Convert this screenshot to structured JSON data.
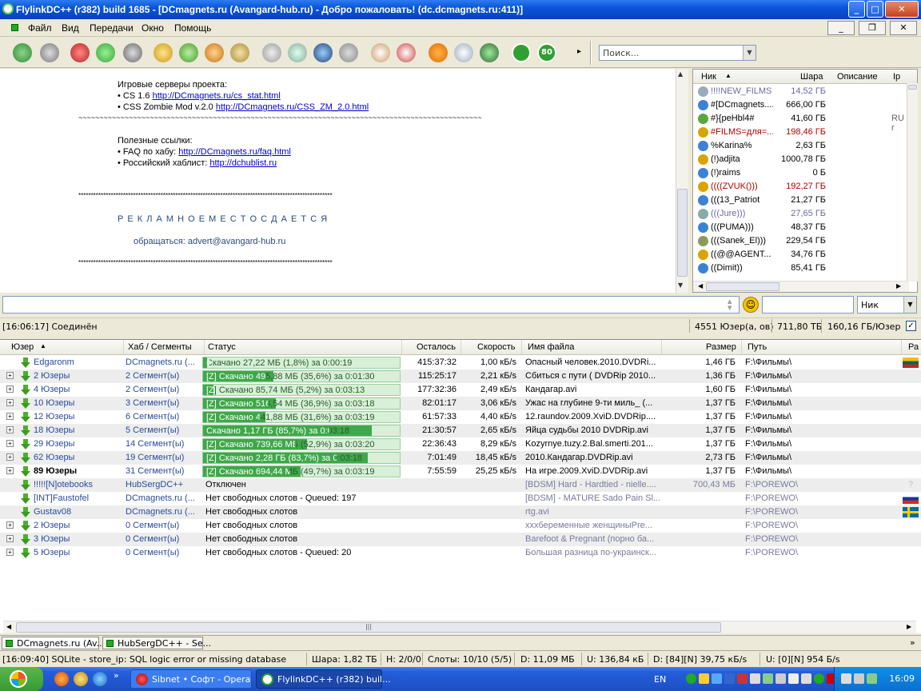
{
  "window": {
    "title": "FlylinkDC++ (r382) build 1685 - [DCmagnets.ru (Avangard-hub.ru) -  Добро пожаловать! (dc.dcmagnets.ru:411)]",
    "minimize": "_",
    "maximize": "□",
    "close": "✕"
  },
  "menu": {
    "items": [
      "Файл",
      "Вид",
      "Передачи",
      "Окно",
      "Помощь"
    ],
    "mdi_min": "_",
    "mdi_restore": "❐",
    "mdi_close": "✕"
  },
  "toolbar": {
    "search_placeholder": "Поиск...",
    "counter_badge": "80"
  },
  "chat": {
    "line1": "Игровые серверы проекта:",
    "line2_prefix": "• CS 1.6 ",
    "line2_link": "http://DCmagnets.ru/cs_stat.html",
    "line3_prefix": "• CSS Zombie Mod v.2.0 ",
    "line3_link": "http://DCmagnets.ru/CSS_ZM_2.0.html",
    "sep_tilde": "~~~~~~~~~~~~~~~~~~~~~~~~~~~~~~~~~~~~~~~~~~~~~~~~~~~~~~~~~~~~~~~~~~~~~~~~~~~~~~~~~~~~~~~~~~~~~~~~",
    "line4": "Полезные ссылки:",
    "line5_prefix": "• FAQ по хабу: ",
    "line5_link": "http://DCmagnets.ru/faq.html",
    "line6_prefix": "• Российский хаблист: ",
    "line6_link": "http://dchublist.ru",
    "sep_star": "******************************************************************************************************",
    "ad": "Р Е К Л А М Н О Е   М Е С Т О   С Д А Е Т С Я",
    "ad_contact": "обращаться: advert@avangard-hub.ru"
  },
  "userlist": {
    "headers": {
      "nick": "Ник",
      "share": "Шара",
      "desc": "Описание",
      "ip": "Ip"
    },
    "rows": [
      {
        "nick": "!!!!NEW_FILMS",
        "share": "14,52 ГБ",
        "desc": "",
        "color": "#6a6a9a",
        "icon": "#9ab"
      },
      {
        "nick": "#[DCmagnets....",
        "share": "666,00 ГБ",
        "desc": "",
        "color": "#000",
        "icon": "#3b82d6"
      },
      {
        "nick": "#}{peHbl4#",
        "share": "41,60 ГБ",
        "desc": "RU r",
        "color": "#000",
        "icon": "#5aa83a"
      },
      {
        "nick": "#FILMS=для=...",
        "share": "198,46 ГБ",
        "desc": "",
        "color": "#b00000",
        "icon": "#d9a400"
      },
      {
        "nick": "%Karina%",
        "share": "2,63 ГБ",
        "desc": "",
        "color": "#000",
        "icon": "#3b82d6"
      },
      {
        "nick": "(!)adjita",
        "share": "1000,78 ГБ",
        "desc": "",
        "color": "#000",
        "icon": "#d9a400"
      },
      {
        "nick": "(!)raims",
        "share": "0 Б",
        "desc": "",
        "color": "#000",
        "icon": "#3b82d6"
      },
      {
        "nick": "((((ZVUK()))",
        "share": "192,27 ГБ",
        "desc": "",
        "color": "#b00000",
        "icon": "#d9a400"
      },
      {
        "nick": "(((13_Patriot",
        "share": "21,27 ГБ",
        "desc": "",
        "color": "#000",
        "icon": "#3b82d6"
      },
      {
        "nick": "(((Jure)))",
        "share": "27,65 ГБ",
        "desc": "",
        "color": "#6a6a9a",
        "icon": "#8aa"
      },
      {
        "nick": "(((PUMA)))",
        "share": "48,37 ГБ",
        "desc": "",
        "color": "#000",
        "icon": "#3b82d6"
      },
      {
        "nick": "(((Sanek_El)))",
        "share": "229,54 ГБ",
        "desc": "",
        "color": "#000",
        "icon": "#8a9a5a"
      },
      {
        "nick": "((@@AGENT...",
        "share": "34,76 ГБ",
        "desc": "",
        "color": "#000",
        "icon": "#d9a400"
      },
      {
        "nick": "((Dimit))",
        "share": "85,41 ГБ",
        "desc": "",
        "color": "#000",
        "icon": "#3b82d6"
      }
    ]
  },
  "filter": {
    "nick_select": "Ник",
    "smiley": "☺"
  },
  "status": {
    "connected": "[16:06:17] Соединён",
    "users": "4551 Юзер(а, ов)",
    "total_share": "711,80 ТБ",
    "per_user": "160,16 ГБ/Юзер"
  },
  "queue": {
    "headers": [
      "Юзер",
      "Хаб / Сегменты",
      "Статус",
      "Осталось",
      "Скорость",
      "Имя файла",
      "Размер",
      "Путь",
      "Ра"
    ],
    "rows": [
      {
        "exp": false,
        "user": "Edgaronm",
        "hub": "DCmagnets.ru (...",
        "status": "Скачано 27,22 МБ (1,8%) за 0:00:19",
        "bar": true,
        "fill": 0.02,
        "left": "415:37:32",
        "speed": "1,00 кБ/s",
        "file": "Опасный человек.2010.DVDRi...",
        "size": "1,46 ГБ",
        "path": "F:\\Фильмы\\",
        "active": true,
        "flag": "lt"
      },
      {
        "exp": true,
        "user": "2 Юзеры",
        "hub": "2 Сегмент(ы)",
        "status": "[Z] Скачано 495,88 МБ (35,6%) за 0:01:30",
        "bar": true,
        "fill": 0.356,
        "left": "115:25:17",
        "speed": "2,21 кБ/s",
        "file": "Сбиться с пути ( DVDRip 2010...",
        "size": "1,36 ГБ",
        "path": "F:\\Фильмы\\",
        "active": true,
        "flag": ""
      },
      {
        "exp": true,
        "user": "4 Юзеры",
        "hub": "2 Сегмент(ы)",
        "status": "[Z] Скачано 85,74 МБ (5,2%) за 0:03:13",
        "bar": true,
        "fill": 0.052,
        "left": "177:32:36",
        "speed": "2,49 кБ/s",
        "file": "Кандагар.avi",
        "size": "1,60 ГБ",
        "path": "F:\\Фильмы\\",
        "active": true,
        "flag": ""
      },
      {
        "exp": true,
        "user": "10 Юзеры",
        "hub": "3 Сегмент(ы)",
        "status": "[Z] Скачано 516,54 МБ (36,9%) за 0:03:18",
        "bar": true,
        "fill": 0.369,
        "left": "82:01:17",
        "speed": "3,06 кБ/s",
        "file": "Ужас на глубине 9-ти миль_ (...",
        "size": "1,37 ГБ",
        "path": "F:\\Фильмы\\",
        "active": true,
        "flag": ""
      },
      {
        "exp": true,
        "user": "12 Юзеры",
        "hub": "6 Сегмент(ы)",
        "status": "[Z] Скачано 441,88 МБ (31,6%) за 0:03:19",
        "bar": true,
        "fill": 0.316,
        "left": "61:57:33",
        "speed": "4,40 кБ/s",
        "file": "12.raundov.2009.XviD.DVDRip....",
        "size": "1,37 ГБ",
        "path": "F:\\Фильмы\\",
        "active": true,
        "flag": ""
      },
      {
        "exp": true,
        "user": "18 Юзеры",
        "hub": "5 Сегмент(ы)",
        "status": "Скачано 1,17 ГБ (85,7%) за 0:03:18",
        "bar": true,
        "fill": 0.857,
        "left": "21:30:57",
        "speed": "2,65 кБ/s",
        "file": "Яйца судьбы 2010 DVDRip.avi",
        "size": "1,37 ГБ",
        "path": "F:\\Фильмы\\",
        "active": true,
        "flag": ""
      },
      {
        "exp": true,
        "user": "29 Юзеры",
        "hub": "14 Сегмент(ы)",
        "status": "[Z] Скачано 739,66 МБ (52,9%) за 0:03:20",
        "bar": true,
        "fill": 0.529,
        "left": "22:36:43",
        "speed": "8,29 кБ/s",
        "file": "Kozyrnye.tuzy.2.Bal.smerti.201...",
        "size": "1,37 ГБ",
        "path": "F:\\Фильмы\\",
        "active": true,
        "flag": ""
      },
      {
        "exp": true,
        "user": "62 Юзеры",
        "hub": "19 Сегмент(ы)",
        "status": "[Z] Скачано 2,28 ГБ (83,7%) за 0:03:18",
        "bar": true,
        "fill": 0.837,
        "left": "7:01:49",
        "speed": "18,45 кБ/s",
        "file": "2010.Кандагар.DVDRip.avi",
        "size": "2,73 ГБ",
        "path": "F:\\Фильмы\\",
        "active": true,
        "flag": ""
      },
      {
        "exp": true,
        "user": "89 Юзеры",
        "hub": "31 Сегмент(ы)",
        "status": "[Z] Скачано 694,44 МБ (49,7%) за 0:03:19",
        "bar": true,
        "fill": 0.497,
        "left": "7:55:59",
        "speed": "25,25 кБ/s",
        "file": "На игре.2009.XviD.DVDRip.avi",
        "size": "1,37 ГБ",
        "path": "F:\\Фильмы\\",
        "active": true,
        "flag": "",
        "bold": true
      },
      {
        "exp": false,
        "user": "!!!!![N]otebooks",
        "hub": "HubSergDC++",
        "status": "Отключен",
        "bar": false,
        "fill": 0,
        "left": "",
        "speed": "",
        "file": "[BDSM] Hard - Hardtied - nielle....",
        "size": "700,43 МБ",
        "path": "F:\\POREWO\\",
        "active": false,
        "flag": "q"
      },
      {
        "exp": false,
        "user": "[INT]Faustofel",
        "hub": "DCmagnets.ru (...",
        "status": "Нет свободных слотов - Queued: 197",
        "bar": false,
        "fill": 0,
        "left": "",
        "speed": "",
        "file": "[BDSM] - MATURE Sado Pain Sl...",
        "size": "",
        "path": "F:\\POREWO\\",
        "active": false,
        "flag": "ru"
      },
      {
        "exp": false,
        "user": "Gustav08",
        "hub": "DCmagnets.ru (...",
        "status": "Нет свободных слотов",
        "bar": false,
        "fill": 0,
        "left": "",
        "speed": "",
        "file": "rtg.avi",
        "size": "",
        "path": "F:\\POREWO\\",
        "active": false,
        "flag": "se"
      },
      {
        "exp": true,
        "user": "2 Юзеры",
        "hub": "0 Сегмент(ы)",
        "status": "Нет свободных слотов",
        "bar": false,
        "fill": 0,
        "left": "",
        "speed": "",
        "file": "xxxбеременные женщиныPre...",
        "size": "",
        "path": "F:\\POREWO\\",
        "active": false,
        "flag": ""
      },
      {
        "exp": true,
        "user": "3 Юзеры",
        "hub": "0 Сегмент(ы)",
        "status": "Нет свободных слотов",
        "bar": false,
        "fill": 0,
        "left": "",
        "speed": "",
        "file": "Barefoot & Pregnant (порно ба...",
        "size": "",
        "path": "F:\\POREWO\\",
        "active": false,
        "flag": ""
      },
      {
        "exp": true,
        "user": "5 Юзеры",
        "hub": "0 Сегмент(ы)",
        "status": "Нет свободных слотов - Queued: 20",
        "bar": false,
        "fill": 0,
        "left": "",
        "speed": "",
        "file": "Большая разница по-украинск...",
        "size": "",
        "path": "F:\\POREWO\\",
        "active": false,
        "flag": ""
      }
    ]
  },
  "tabs": [
    "DCmagnets.ru (Av...",
    "HubSergDC++ - Se..."
  ],
  "bottom": {
    "log": "[16:09:40] SQLite - store_ip: SQL logic error or missing database",
    "share": "Шара: 1,82 ТБ",
    "hubs": "H: 2/0/0",
    "slots": "Слоты: 10/10 (5/5)",
    "down": "D: 11,09 МБ",
    "up": "U: 136,84 кБ",
    "drate": "D: [84][N] 39,75 кБ/s",
    "urate": "U: [0][N] 954 Б/s"
  },
  "taskbar": {
    "btn1": "Sibnet • Софт - Opera",
    "btn2": "FlylinkDC++ (r382) buil...",
    "lang": "EN",
    "clock": "16:09",
    "more": "»"
  }
}
